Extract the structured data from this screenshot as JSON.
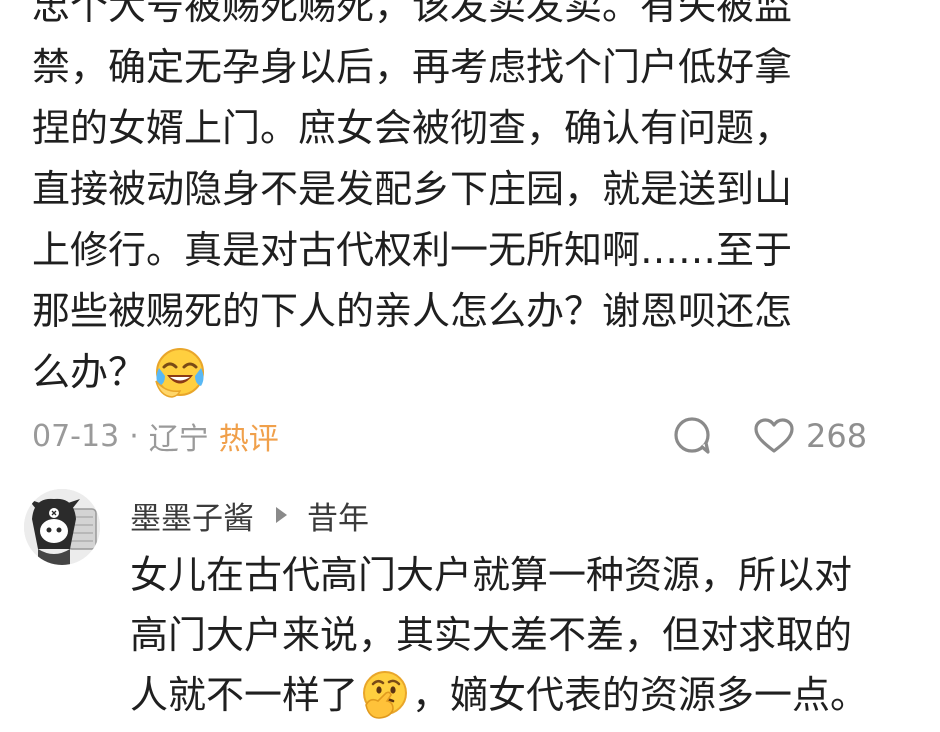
{
  "comment": {
    "lines": [
      "忠个大号被赐死赐死，该发卖发卖。有失被监",
      "禁，确定无孕身以后，再考虑找个门户低好拿",
      "捏的女婿上门。庶女会被彻查，确认有问题，",
      "直接被动隐身不是发配乡下庄园，就是送到山",
      "上修行。真是对古代权利一无所知啊……至于",
      "那些被赐死的下人的亲人怎么办？谢恩呗还怎",
      "么办？"
    ],
    "emoji": "laughing-crying-emoji",
    "meta": {
      "date": "07-13",
      "separator": "·",
      "location": "辽宁",
      "badge": "热评"
    },
    "like_count": "268"
  },
  "reply": {
    "username": "墨墨子酱",
    "reply_to": "昔年",
    "lines": [
      "女儿在古代高门大户就算一种资源，所以对",
      "高门大户来说，其实大差不差，但对求取的"
    ],
    "line3_before": "人就不一样了",
    "line3_after": "，嫡女代表的资源多一点。",
    "emoji": "thinking-face-emoji"
  },
  "colors": {
    "badge": "#f0a04b",
    "meta": "#9a9a9a",
    "text": "#1f1f1f"
  }
}
